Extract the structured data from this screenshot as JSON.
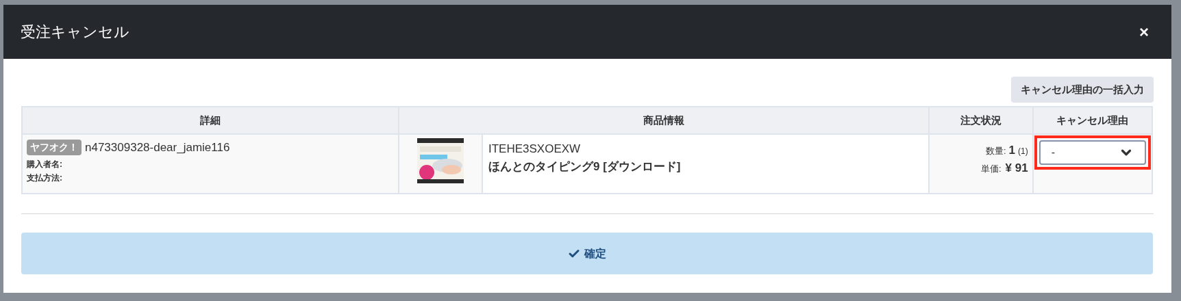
{
  "dialog": {
    "title": "受注キャンセル",
    "close": "×"
  },
  "bulk_button": "キャンセル理由の一括入力",
  "table": {
    "columns": [
      "詳細",
      "商品情報",
      "注文状況",
      "キャンセル理由"
    ],
    "rows": [
      {
        "badge": "ヤフオク！",
        "order_id": "n473309328-dear_jamie116",
        "buyer_label": "購入者名:",
        "payment_label": "支払方法:",
        "product": {
          "code": "ITEHE3SXOEXW",
          "name": "ほんとのタイピング9 [ダウンロード]"
        },
        "quantity_label": "数量:",
        "quantity": "1",
        "quantity_note": "(1)",
        "price_label": "単価:",
        "price": "¥ 91",
        "reason": {
          "value": "-",
          "highlighted": true
        }
      }
    ]
  },
  "confirm_button": "確定"
}
